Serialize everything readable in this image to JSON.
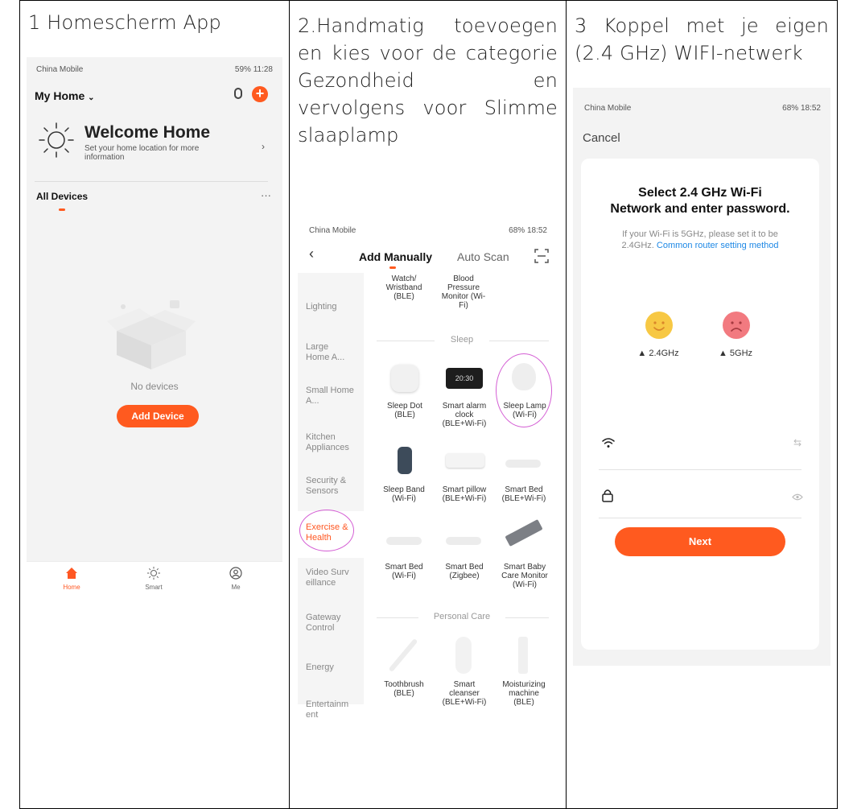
{
  "columns": [
    {
      "caption": "1 Homescherm App"
    },
    {
      "caption": "2.Handmatig toevoegen en kies voor de categorie Gezondheid en vervolgens voor Slimme slaaplamp"
    },
    {
      "caption": "3 Koppel met je eigen (2.4 GHz) WIFI-netwerk"
    }
  ],
  "screen1": {
    "status_left": "China Mobile",
    "status_right": "59% 11:28",
    "home_title": "My Home",
    "welcome_title": "Welcome Home",
    "welcome_sub": "Set your home location for more information",
    "all_devices": "All Devices",
    "more_dots": "···",
    "no_devices": "No devices",
    "add_device": "Add Device",
    "nav": [
      "Home",
      "Smart",
      "Me"
    ],
    "accent": "#ff5722"
  },
  "screen2": {
    "status_left": "China Mobile",
    "status_right": "68% 18:52",
    "tab_manual": "Add Manually",
    "tab_auto": "Auto Scan",
    "categories": [
      "Lighting",
      "Large Home A...",
      "Small Home A...",
      "Kitchen Appliances",
      "Security & Sensors",
      "Exercise & Health",
      "Video Surv eillance",
      "Gateway Control",
      "Energy",
      "Entertainm ent"
    ],
    "top_products": [
      "Watch/ Wristband (BLE)",
      "Blood Pressure Monitor (Wi-Fi)"
    ],
    "section_sleep": "Sleep",
    "sleep_row1": [
      "Sleep Dot (BLE)",
      "Smart alarm clock (BLE+Wi-Fi)",
      "Sleep Lamp (Wi-Fi)"
    ],
    "alarm_display": "20:30",
    "sleep_row2": [
      "Sleep Band (Wi-Fi)",
      "Smart pillow (BLE+Wi-Fi)",
      "Smart Bed (BLE+Wi-Fi)"
    ],
    "sleep_row3": [
      "Smart Bed (Wi-Fi)",
      "Smart Bed (Zigbee)",
      "Smart Baby Care Monitor (Wi-Fi)"
    ],
    "section_personal": "Personal Care",
    "personal_row": [
      "Toothbrush (BLE)",
      "Smart cleanser (BLE+Wi-Fi)",
      "Moisturizing machine (BLE)"
    ]
  },
  "screen3": {
    "status_left": "China Mobile",
    "status_right": "68% 18:52",
    "cancel": "Cancel",
    "title_line1": "Select 2.4 GHz Wi-Fi",
    "title_line2": "Network and enter password.",
    "desc_line1": "If your Wi-Fi is 5GHz, please set it to be",
    "desc_prefix": "2.4GHz.",
    "desc_link": "Common router setting method",
    "band_24": "2.4GHz",
    "band_5": "5GHz",
    "next": "Next",
    "link_color": "#1e88e5"
  }
}
